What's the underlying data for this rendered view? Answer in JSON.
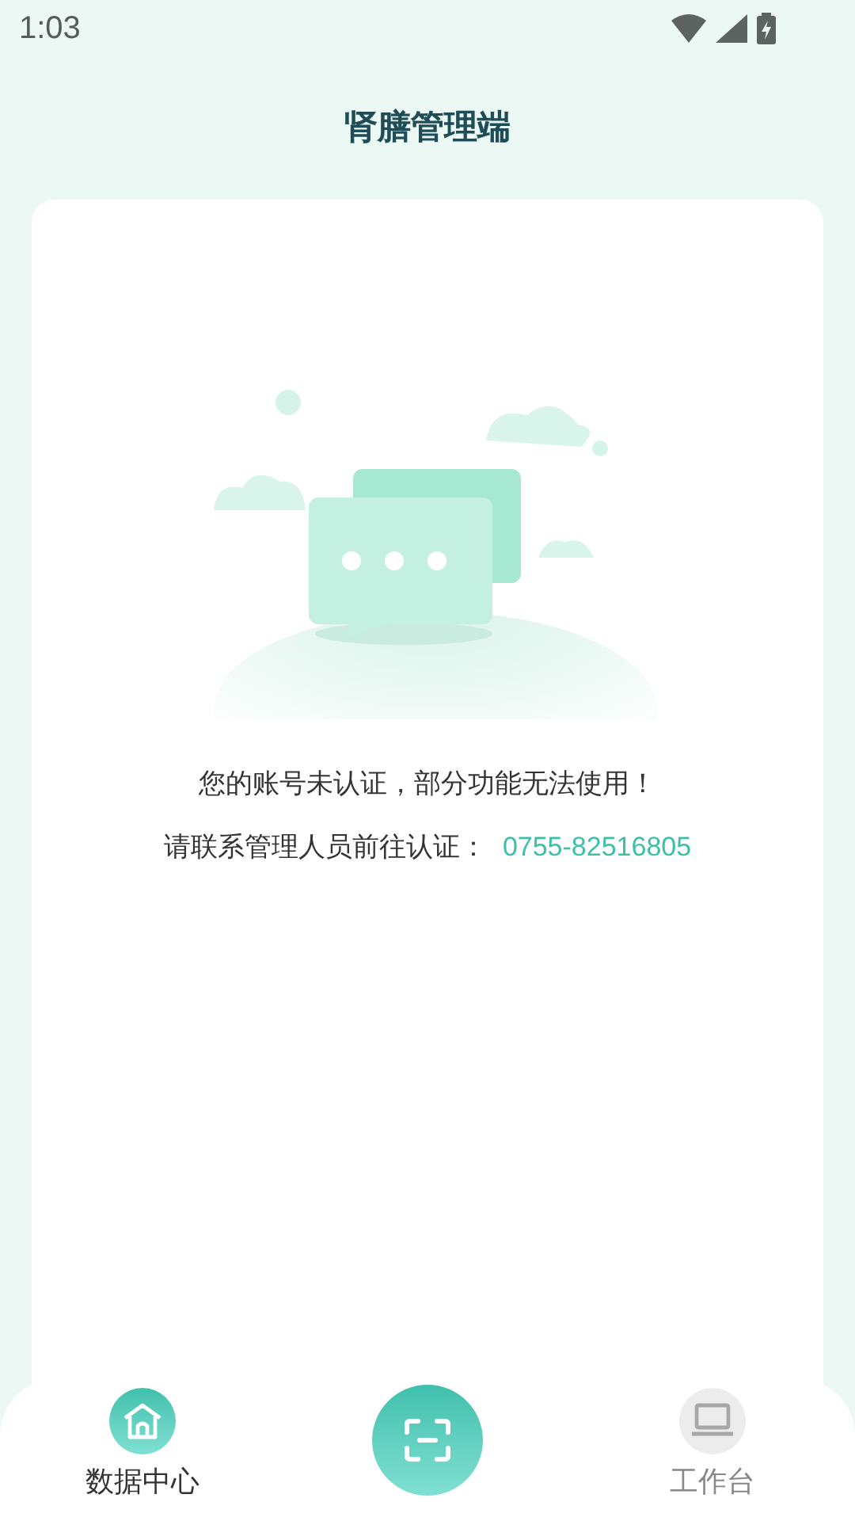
{
  "status_bar": {
    "time": "1:03"
  },
  "header": {
    "title": "肾膳管理端"
  },
  "notice": {
    "message": "您的账号未认证，部分功能无法使用！",
    "contact_label": "请联系管理人员前往认证：",
    "phone": "0755-82516805"
  },
  "bottom_nav": [
    {
      "label": "数据中心",
      "selected": true
    },
    {
      "label": "工作台",
      "selected": false
    }
  ]
}
